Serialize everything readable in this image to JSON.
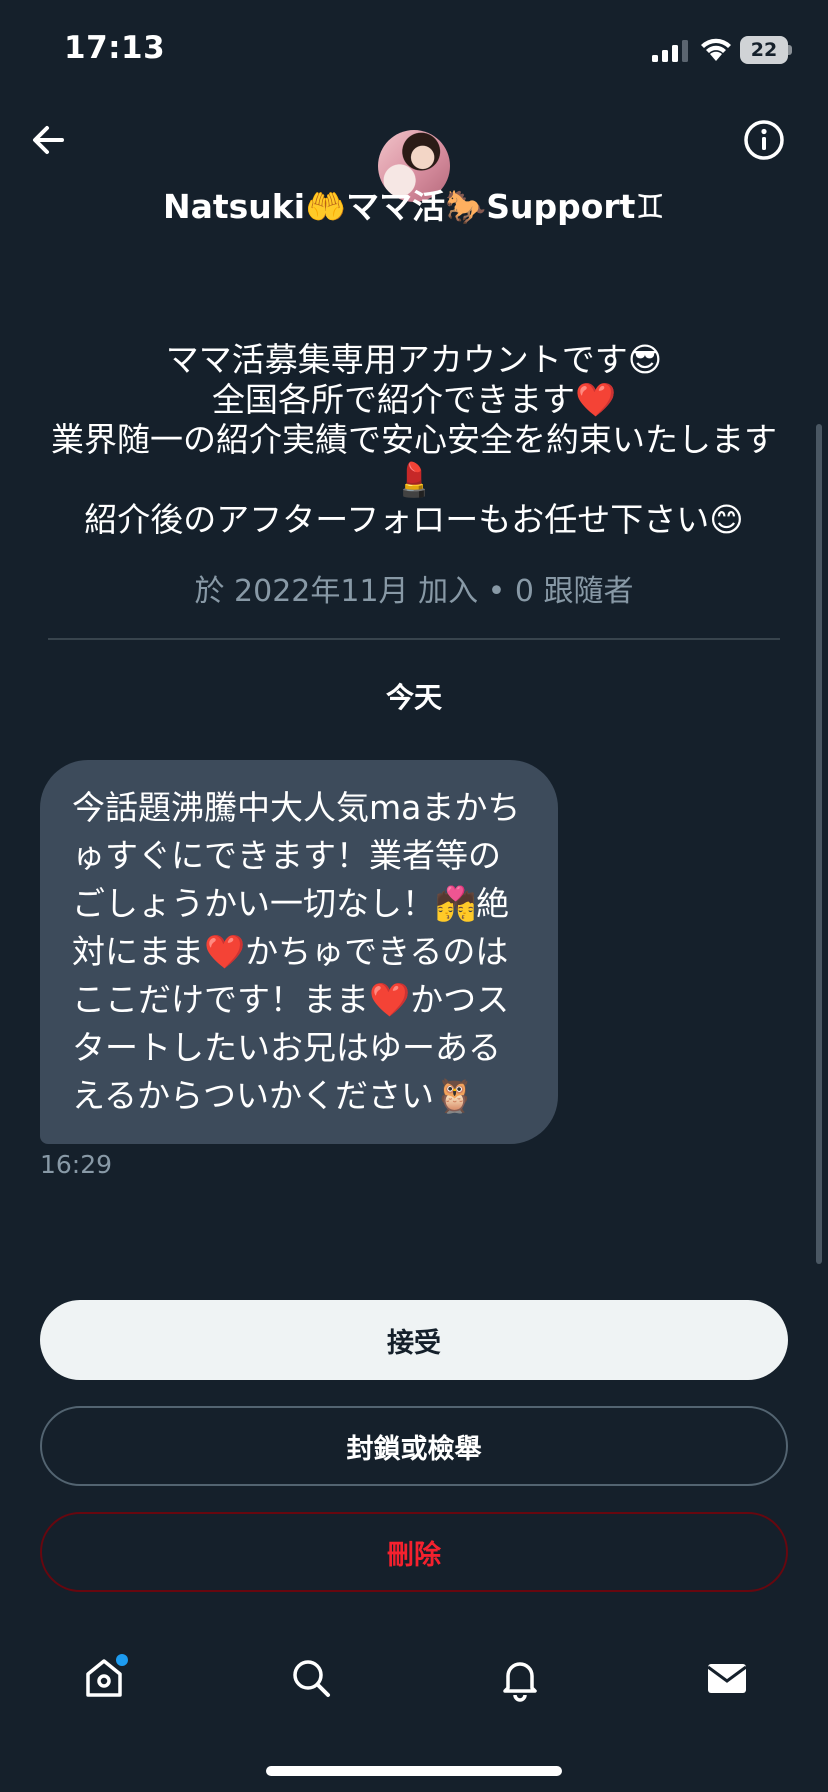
{
  "status_bar": {
    "time": "17:13",
    "battery": "22"
  },
  "header": {
    "display_name": "Natsuki🤲ママ活🐎Support♊",
    "back_icon": "arrow-left-icon",
    "info_icon": "info-circle-icon"
  },
  "profile": {
    "bio_lines": [
      "ママ活募集専用アカウントです😎",
      "全国各所で紹介できます❤️",
      "業界随一の紹介実績で安心安全を約束いたします💄",
      "紹介後のアフターフォローもお任せ下さい😊"
    ],
    "join_info": "於 2022年11月 加入 • 0 跟隨者"
  },
  "conversation": {
    "date_label": "今天",
    "message": {
      "text": "今話題沸騰中大人気maまかちゅすぐにできます！業者等のごしょうかい一切なし！💏絶対にまま❤️かちゅできるのはここだけです！まま❤️かつスタートしたいお兄はゆーあるえるからついかください🦉",
      "time": "16:29"
    }
  },
  "actions": {
    "accept_label": "接受",
    "block_label": "封鎖或檢舉",
    "delete_label": "刪除"
  },
  "tab_bar": {
    "items": [
      {
        "icon": "home-icon",
        "has_badge": true
      },
      {
        "icon": "search-icon"
      },
      {
        "icon": "bell-icon"
      },
      {
        "icon": "mail-icon"
      }
    ]
  },
  "colors": {
    "background": "#15202b",
    "bubble": "#3d4b5b",
    "muted_text": "#8899a6",
    "delete_red": "#f4212e",
    "badge_blue": "#1d9bf0"
  }
}
